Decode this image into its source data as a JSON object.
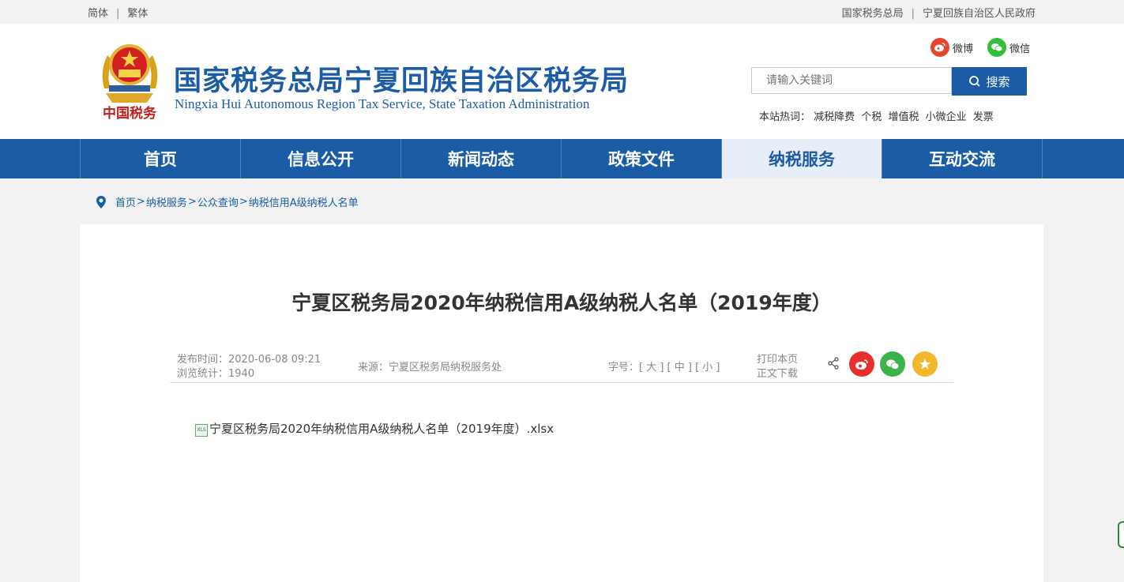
{
  "topbar": {
    "simplified": "简体",
    "traditional": "繁体",
    "link1": "国家税务总局",
    "link2": "宁夏回族自治区人民政府",
    "sep": "|"
  },
  "header": {
    "emblem_text": "中国税务",
    "title": "国家税务总局宁夏回族自治区税务局",
    "subtitle": "Ningxia Hui Autonomous Region Tax Service, State Taxation Administration",
    "weibo": "微博",
    "wechat": "微信",
    "search_placeholder": "请输入关键词",
    "search_button": "搜索",
    "hot_label": "本站热词：",
    "hot_words": [
      "减税降费",
      "个税",
      "增值税",
      "小微企业",
      "发票"
    ]
  },
  "nav": {
    "items": [
      "首页",
      "信息公开",
      "新闻动态",
      "政策文件",
      "纳税服务",
      "互动交流"
    ],
    "active_index": 4,
    "active_color": "#1c5ca7"
  },
  "breadcrumb": {
    "items": [
      "首页",
      "纳税服务",
      "公众查询",
      "纳税信用A级纳税人名单"
    ],
    "sep": ">"
  },
  "article": {
    "title": "宁夏区税务局2020年纳税信用A级纳税人名单（2019年度）",
    "publish": "发布时间：2020-06-08 09:21",
    "views": "浏览统计：1940",
    "source": "来源：宁夏区税务局纳税服务处",
    "font_size": "字号：[ 大 ] [ 中 ] [ 小 ]",
    "print": "打印本页",
    "download": "正文下载",
    "attachment": "宁夏区税务局2020年纳税信用A级纳税人名单（2019年度）.xlsx",
    "xls_icon_text": "XLS"
  }
}
